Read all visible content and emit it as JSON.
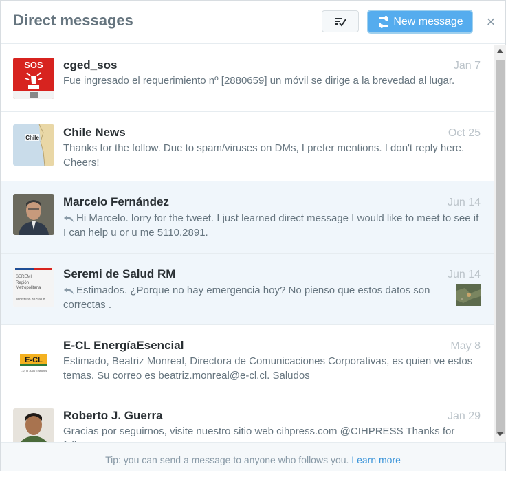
{
  "header": {
    "title": "Direct messages",
    "new_message_label": "New message",
    "close_symbol": "×",
    "mark_read_icon": "mark-all-read-icon"
  },
  "messages": [
    {
      "name": "cged_sos",
      "date": "Jan 7",
      "text": "Fue ingresado el requerimiento nº [2880659] un móvil se dirige a la brevedad al lugar.",
      "reply": false,
      "unread": false,
      "avatar": "sos-logo",
      "avatar_text": "SOS"
    },
    {
      "name": "Chile News",
      "date": "Oct 25",
      "text": "Thanks for the follow. Due to spam/viruses on DMs, I prefer mentions. I don't reply here. Cheers!",
      "reply": false,
      "unread": false,
      "avatar": "chile-map",
      "avatar_text": "Chile"
    },
    {
      "name": "Marcelo Fernández",
      "date": "Jun 14",
      "text": "Hi Marcelo. lorry for the tweet. I just learned direct message I would like to meet to see if I can help u or u me 5110.2891.",
      "reply": true,
      "unread": true,
      "avatar": "person-photo"
    },
    {
      "name": "Seremi de Salud RM",
      "date": "Jun 14",
      "text": "Estimados. ¿Porque no hay emergencia hoy? No pienso que estos datos son correctas .",
      "reply": true,
      "unread": true,
      "avatar": "seremi-logo",
      "avatar_lines": [
        "SEREMI",
        "Región",
        "Metropolitana",
        "Ministerio de Salud"
      ],
      "has_thumbnail": true
    },
    {
      "name": "E-CL EnergíaEsencial",
      "date": "May 8",
      "text": "Estimado, Beatriz Monreal, Directora de Comunicaciones Corporativas, es quien ve estos temas. Su correo es beatriz.monreal@e-cl.cl. Saludos",
      "reply": false,
      "unread": false,
      "avatar": "ecl-logo",
      "avatar_text": "E-CL",
      "avatar_subtext": "I-D, TI 3000 ENNOIN"
    },
    {
      "name": "Roberto J. Guerra",
      "date": "Jan 29",
      "text": "Gracias por seguirnos, visite nuestro sitio web cihpress.com @CIHPRESS Thanks for follow",
      "reply": false,
      "unread": false,
      "avatar": "person-photo"
    }
  ],
  "footer": {
    "tip": "Tip: you can send a message to anyone who follows you.",
    "link": "Learn more"
  },
  "colors": {
    "accent": "#55acee",
    "unread_bg": "#f0f6fb",
    "link": "#3b94d9"
  }
}
